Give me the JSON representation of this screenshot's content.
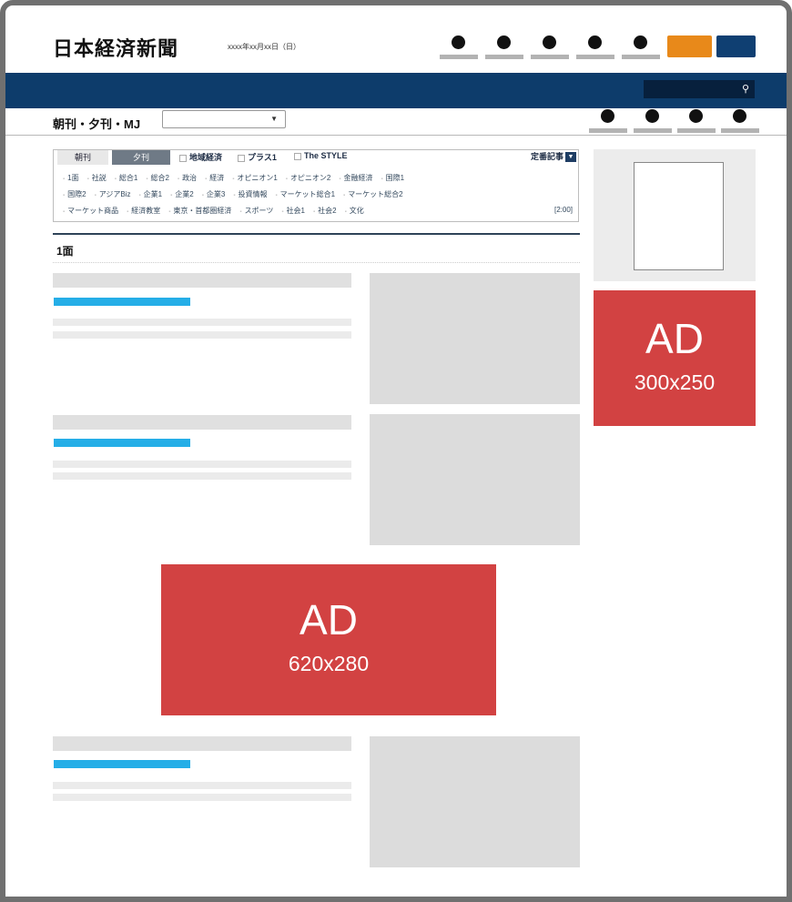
{
  "header": {
    "logo": "日本経済新聞",
    "date": "xxxx年xx月xx日（日）",
    "icons": [
      "header-icon-1",
      "header-icon-2",
      "header-icon-3",
      "header-icon-4",
      "header-icon-5"
    ],
    "orange_button_color": "#e8891a",
    "blue_button_color": "#0f3f72"
  },
  "nav": {
    "band_color": "#0d3c6b",
    "search_icon": "search-icon",
    "search_glyph": "⚲"
  },
  "subheader": {
    "edition_label": "朝刊・夕刊・MJ",
    "select_value": "",
    "select_arrow": "▼",
    "icons": [
      "sub-icon-1",
      "sub-icon-2",
      "sub-icon-3",
      "sub-icon-4"
    ]
  },
  "paper_tabs": {
    "tabs": [
      "朝刊",
      "夕刊"
    ],
    "links": [
      "地域経済",
      "プラス1",
      "The STYLE"
    ],
    "teiban": "定番記事",
    "teiban_arrow": "▼",
    "rows": [
      [
        "1面",
        "社説",
        "総合1",
        "総合2",
        "政治",
        "経済",
        "オピニオン1",
        "オピニオン2",
        "金融経済",
        "国際1"
      ],
      [
        "国際2",
        "アジアBiz",
        "企業1",
        "企業2",
        "企業3",
        "投資情報",
        "マーケット総合1",
        "マーケット総合2"
      ],
      [
        "マーケット商品",
        "経済教室",
        "東京・首都圏経済",
        "スポーツ",
        "社会1",
        "社会2",
        "文化"
      ]
    ],
    "time": "[2:00]"
  },
  "section": {
    "title": "1面"
  },
  "ads": {
    "side": {
      "label": "AD",
      "size": "300x250"
    },
    "main": {
      "label": "AD",
      "size": "620x280"
    },
    "color": "#d24242"
  }
}
